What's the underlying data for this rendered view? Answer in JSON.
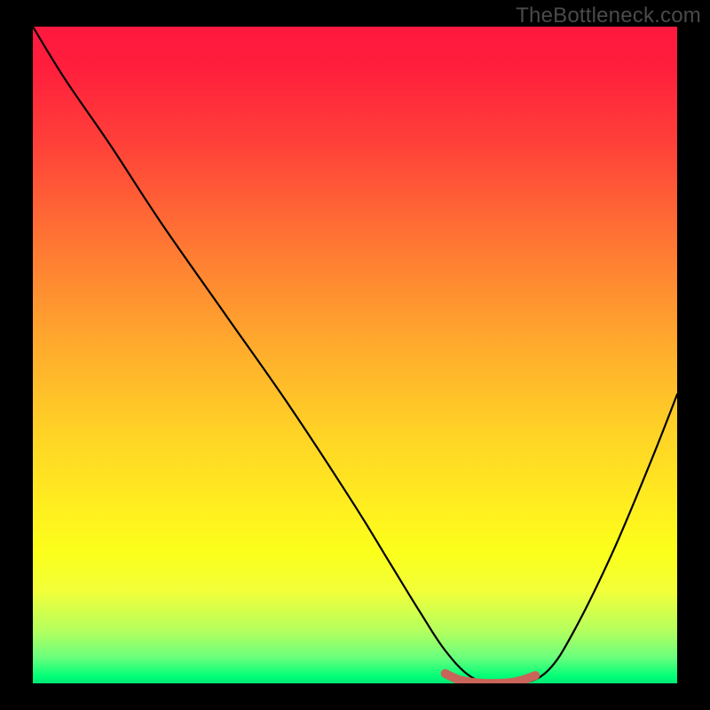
{
  "watermark": "TheBottleneck.com",
  "chart_data": {
    "type": "line",
    "title": "",
    "xlabel": "",
    "ylabel": "",
    "series": [
      {
        "name": "curve",
        "x": [
          0,
          5,
          12,
          20,
          30,
          40,
          50,
          55,
          60,
          64,
          68,
          72,
          76,
          80,
          84,
          90,
          96,
          100
        ],
        "y": [
          100,
          92,
          82,
          70,
          56,
          42,
          27,
          19,
          11,
          5,
          1,
          0,
          0,
          2,
          8,
          20,
          34,
          44
        ]
      },
      {
        "name": "min-marker",
        "x": [
          64,
          66,
          68,
          70,
          72,
          74,
          76,
          78
        ],
        "y": [
          1.5,
          0.6,
          0.2,
          0.0,
          0.0,
          0.1,
          0.5,
          1.2
        ]
      }
    ],
    "xlim": [
      0,
      100
    ],
    "ylim": [
      0,
      100
    ],
    "legend": false
  },
  "colors": {
    "curve": "#000000",
    "marker": "#c86459",
    "background_top": "#ff183f",
    "background_bottom": "#00e676",
    "frame": "#000000",
    "watermark": "#4a4a4a"
  }
}
